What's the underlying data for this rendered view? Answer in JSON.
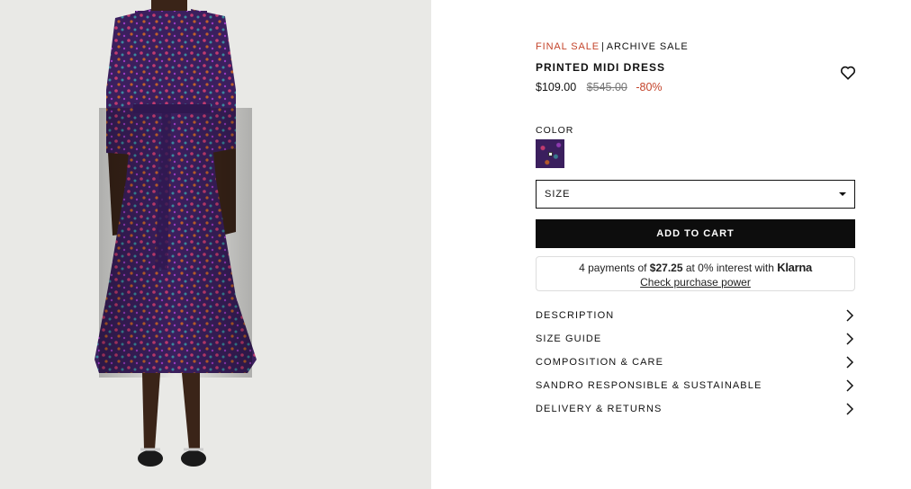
{
  "photo": {
    "alt_icon": "product-photo"
  },
  "product": {
    "sale_tag": "FINAL SALE",
    "separator": "|",
    "collection": "ARCHIVE SALE",
    "title": "PRINTED MIDI DRESS",
    "price_now": "$109.00",
    "price_old": "$545.00",
    "discount": "-80%",
    "wishlist_icon": "heart-icon"
  },
  "color": {
    "label": "COLOR"
  },
  "size": {
    "label": "SIZE"
  },
  "cart": {
    "label": "ADD TO CART"
  },
  "klarna": {
    "prefix": "4 payments of",
    "amount": "$27.25",
    "middle": "at 0% interest with",
    "brand": "Klarna",
    "link": "Check purchase power"
  },
  "accordion": [
    {
      "label": "DESCRIPTION"
    },
    {
      "label": "SIZE GUIDE"
    },
    {
      "label": "COMPOSITION & CARE"
    },
    {
      "label": "SANDRO RESPONSIBLE & SUSTAINABLE"
    },
    {
      "label": "DELIVERY & RETURNS"
    }
  ],
  "colors": {
    "sale_red": "#c4442b",
    "button_black": "#0d0d0d",
    "photo_bg": "#e9e9e6",
    "dress_base": "#3b1f5e"
  }
}
